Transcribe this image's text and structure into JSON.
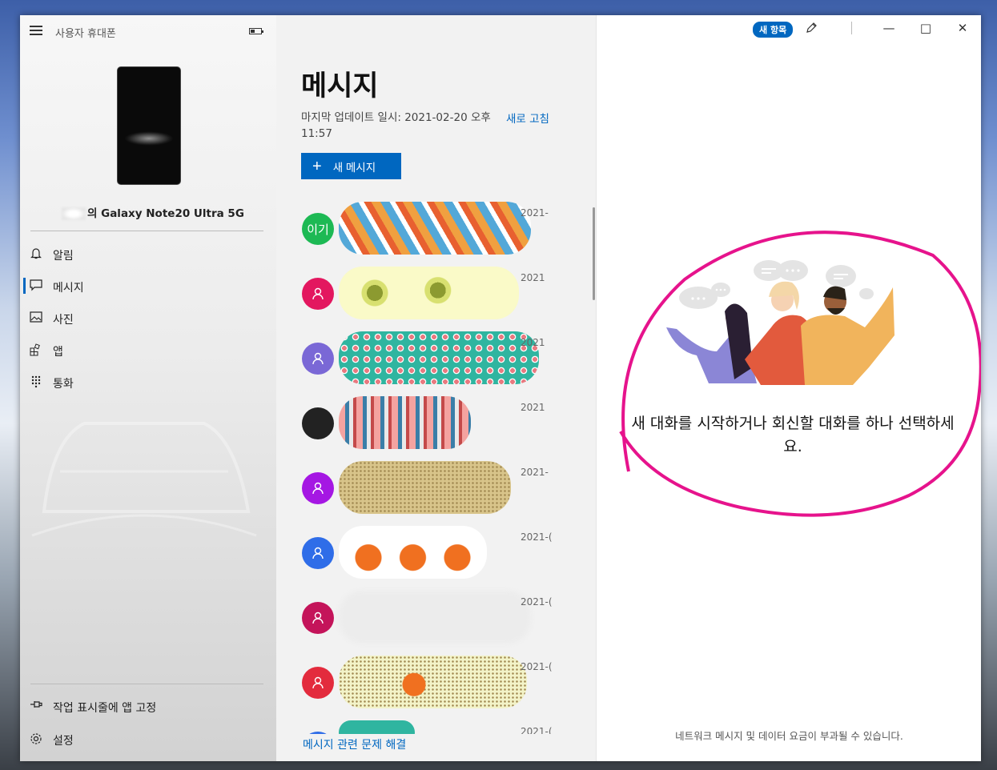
{
  "app": {
    "title": "사용자 휴대폰",
    "device_name": "의 Galaxy Note20 Ultra 5G"
  },
  "nav": {
    "items": [
      {
        "label": "알림",
        "icon": "bell-icon"
      },
      {
        "label": "메시지",
        "icon": "message-icon",
        "active": true
      },
      {
        "label": "사진",
        "icon": "photo-icon"
      },
      {
        "label": "앱",
        "icon": "apps-icon"
      },
      {
        "label": "통화",
        "icon": "dialpad-icon"
      }
    ],
    "pin_label": "작업 표시줄에 앱 고정",
    "settings_label": "설정"
  },
  "messages": {
    "title": "메시지",
    "last_update": "마지막 업데이트 일시: 2021-02-20 오후 11:57",
    "refresh_label": "새로 고침",
    "new_message_label": "새 메시지",
    "troubleshoot_label": "메시지 관련 문제 해결",
    "conversations": [
      {
        "avatar_text": "이기",
        "avatar_color": "#1db954",
        "date": "2021-"
      },
      {
        "avatar_text": "",
        "avatar_color": "#e3175f",
        "date": "2021"
      },
      {
        "avatar_text": "",
        "avatar_color": "#7a68d6",
        "date": "2021"
      },
      {
        "avatar_text": "",
        "avatar_color": "#222222",
        "date": "2021"
      },
      {
        "avatar_text": "",
        "avatar_color": "#a517e3",
        "date": "2021-"
      },
      {
        "avatar_text": "",
        "avatar_color": "#2f6de8",
        "date": "2021-("
      },
      {
        "avatar_text": "",
        "avatar_color": "#c4145a",
        "date": "2021-("
      },
      {
        "avatar_text": "",
        "avatar_color": "#e32b3d",
        "date": "2021-("
      },
      {
        "avatar_text": "",
        "avatar_color": "#2f6de8",
        "date": "2021-("
      }
    ]
  },
  "detail": {
    "new_badge": "새 항목",
    "prompt": "새 대화를 시작하거나 회신할 대화를 하나 선택하세요.",
    "fee_notice": "네트워크 메시지 및 데이터 요금이 부과될 수 있습니다."
  },
  "colors": {
    "accent": "#0067c0",
    "annotation": "#e6138c"
  }
}
